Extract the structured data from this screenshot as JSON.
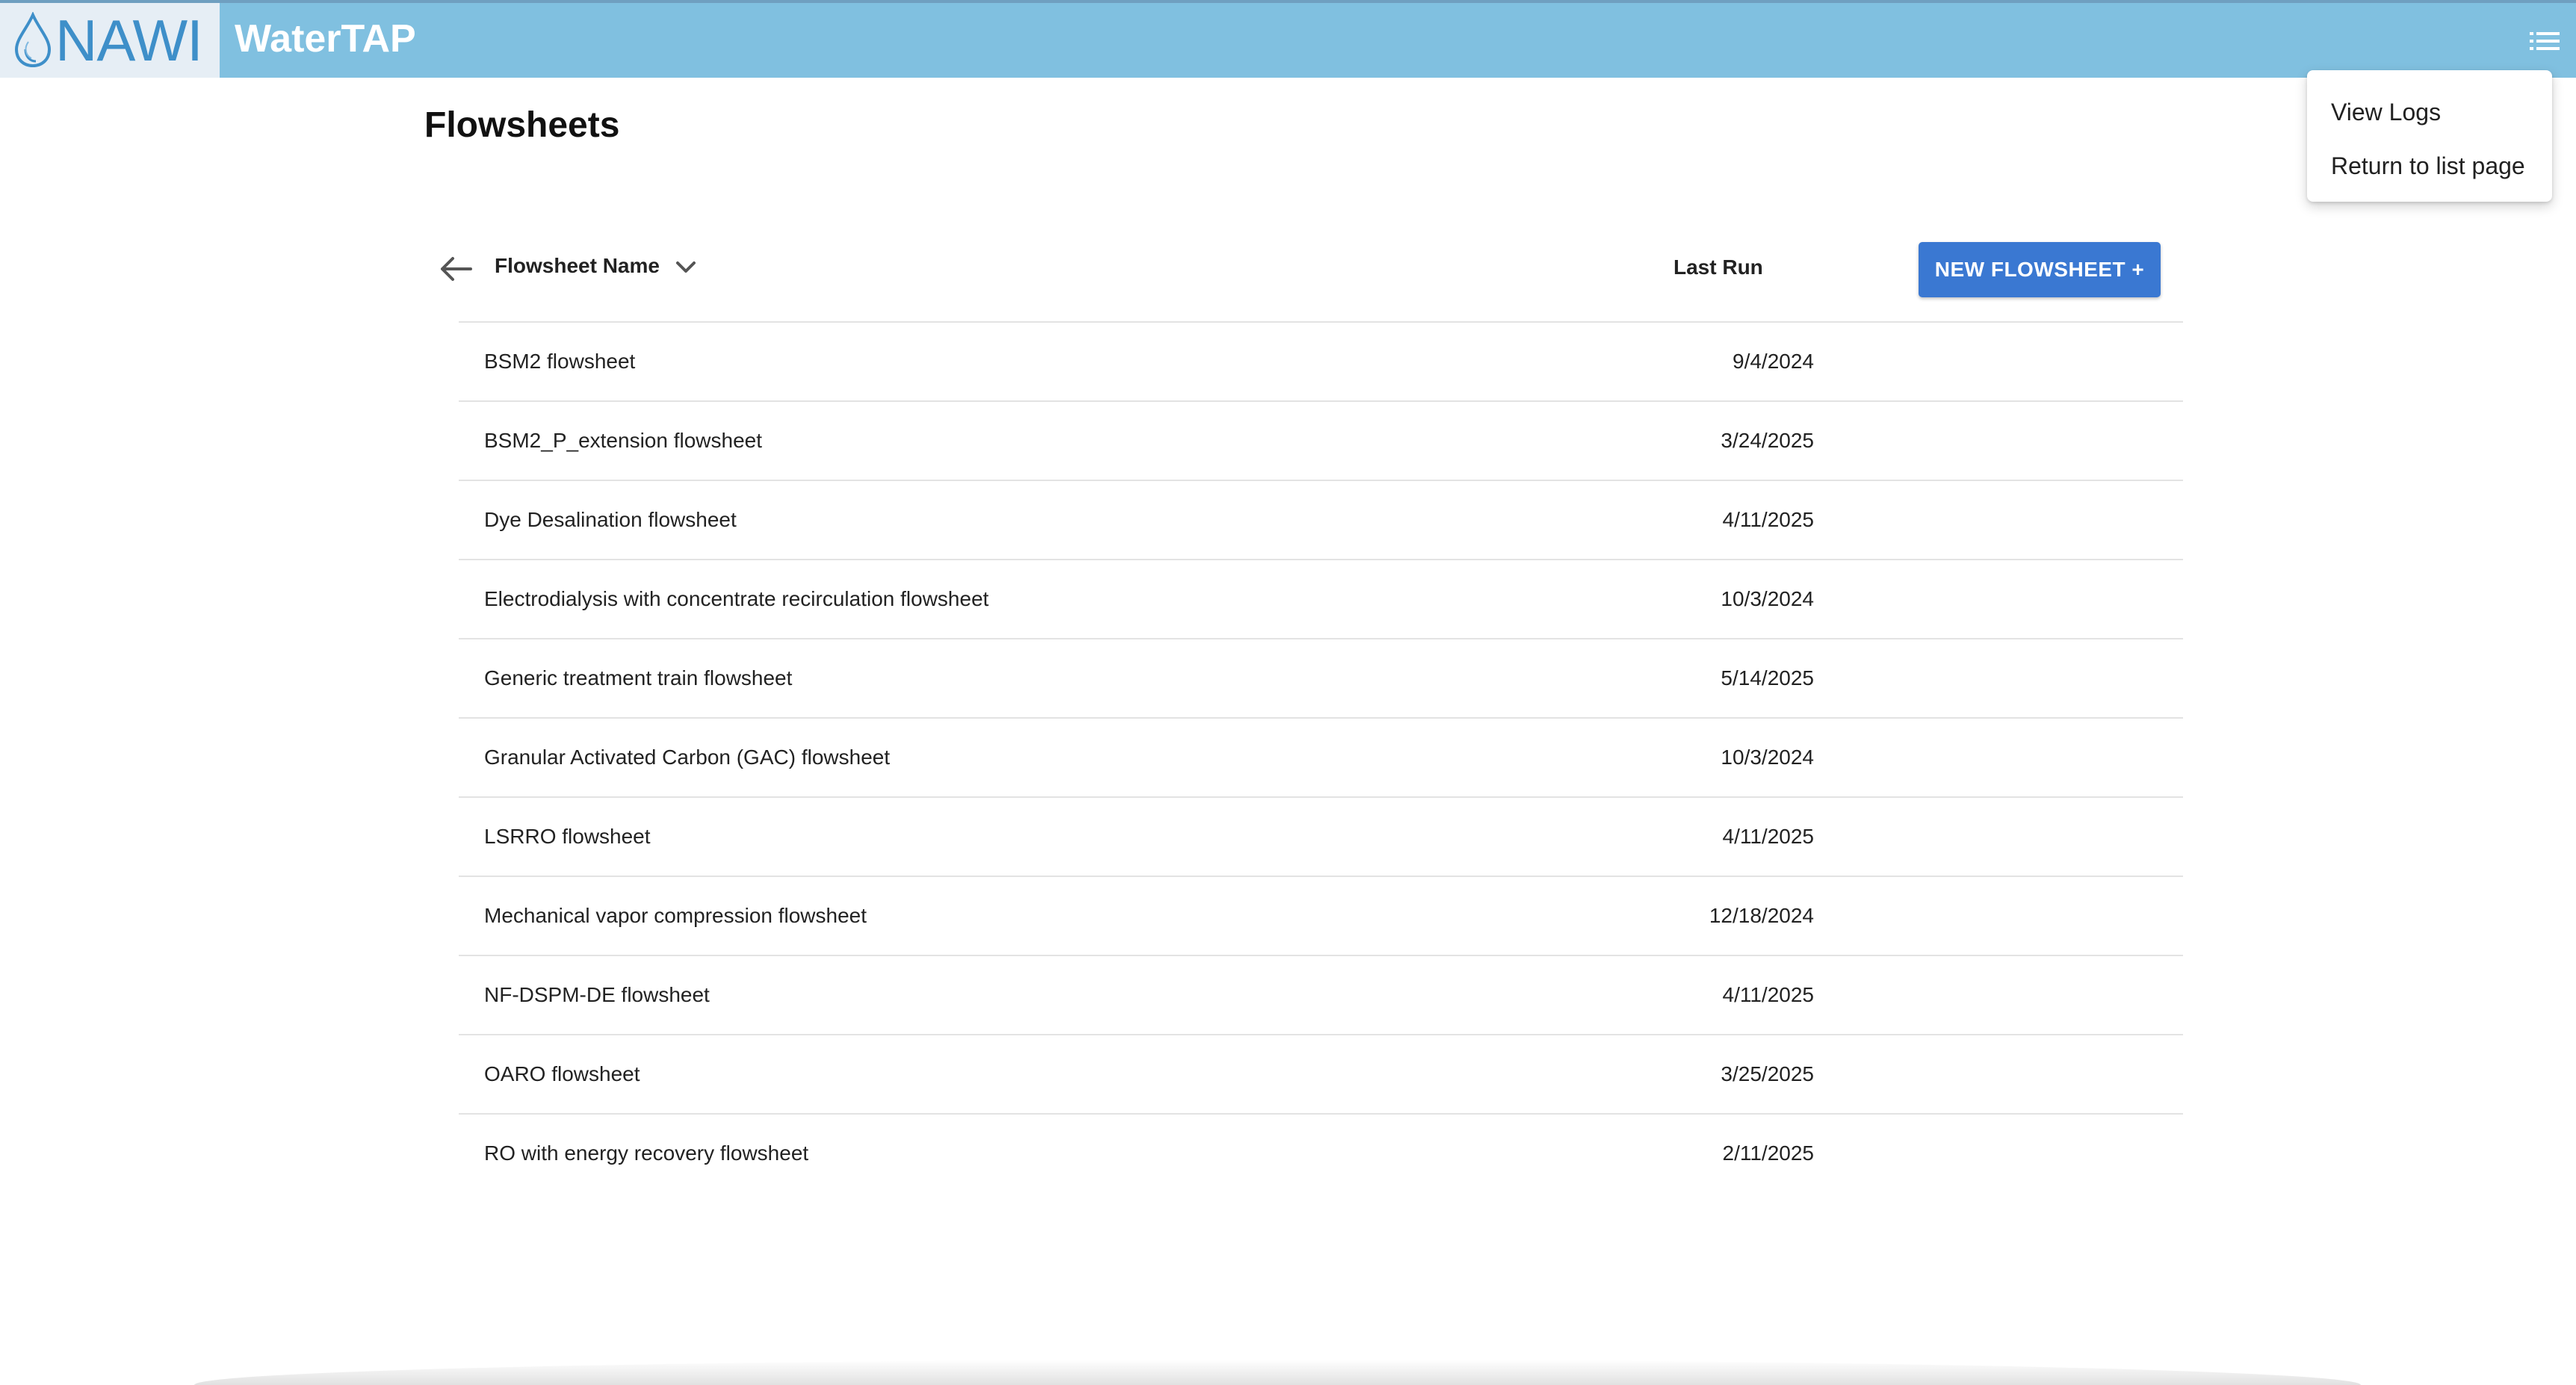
{
  "header": {
    "logo_text": "NAWI",
    "app_title": "WaterTAP",
    "menu_icon": "list-menu-icon",
    "colors": {
      "bar": "#80c0e0",
      "logo_bg": "#e6eef5",
      "logo_text": "#3e8fc9"
    }
  },
  "menu": {
    "items": [
      {
        "label": "View Logs"
      },
      {
        "label": "Return to list page"
      }
    ]
  },
  "page": {
    "title": "Flowsheets"
  },
  "table": {
    "back_icon": "arrow-left-icon",
    "sort_icon": "chevron-down-icon",
    "col_name": "Flowsheet Name",
    "col_last_run": "Last Run",
    "new_button": "NEW FLOWSHEET +",
    "accent_color": "#3a78d2",
    "rows": [
      {
        "name": "BSM2 flowsheet",
        "last_run": "9/4/2024"
      },
      {
        "name": "BSM2_P_extension flowsheet",
        "last_run": "3/24/2025"
      },
      {
        "name": "Dye Desalination flowsheet",
        "last_run": "4/11/2025"
      },
      {
        "name": "Electrodialysis with concentrate recirculation flowsheet",
        "last_run": "10/3/2024"
      },
      {
        "name": "Generic treatment train flowsheet",
        "last_run": "5/14/2025"
      },
      {
        "name": "Granular Activated Carbon (GAC) flowsheet",
        "last_run": "10/3/2024"
      },
      {
        "name": "LSRRO flowsheet",
        "last_run": "4/11/2025"
      },
      {
        "name": "Mechanical vapor compression flowsheet",
        "last_run": "12/18/2024"
      },
      {
        "name": "NF-DSPM-DE flowsheet",
        "last_run": "4/11/2025"
      },
      {
        "name": "OARO flowsheet",
        "last_run": "3/25/2025"
      },
      {
        "name": "RO with energy recovery flowsheet",
        "last_run": "2/11/2025"
      }
    ]
  }
}
